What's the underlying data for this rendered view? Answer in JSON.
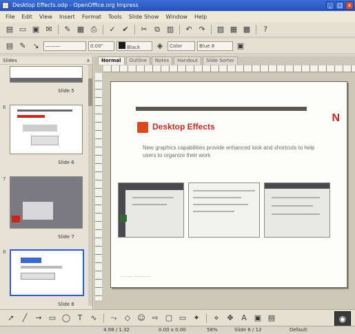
{
  "window": {
    "title": "Desktop Effects.odp - OpenOffice.org Impress",
    "buttons": [
      "_",
      "□",
      "x"
    ]
  },
  "menubar": [
    "File",
    "Edit",
    "View",
    "Insert",
    "Format",
    "Tools",
    "Slide Show",
    "Window",
    "Help"
  ],
  "toolbar2": {
    "line_style": "———",
    "line_width": "0.00\"",
    "color": "Black",
    "area_style": "Color",
    "area_color": "Blue 8"
  },
  "slides_panel": {
    "title": "Slides",
    "close": "x",
    "slides": [
      {
        "num": "",
        "name": "Slide 5"
      },
      {
        "num": "6",
        "name": "Slide 6"
      },
      {
        "num": "7",
        "name": "Slide 7"
      },
      {
        "num": "8",
        "name": "Slide 8"
      }
    ]
  },
  "tabs": [
    "Normal",
    "Outline",
    "Notes",
    "Handout",
    "Slide Sorter"
  ],
  "slide": {
    "title": "Desktop Effects",
    "logo": "N",
    "body": "New graphics capabilities provide enhanced look and shortcuts to help users to organize their work",
    "footer": "-- ----- -----------"
  },
  "statusbar": {
    "position": "4.98 / 1.32",
    "size": "0.00 x 0.00",
    "zoom": "58%",
    "slide": "Slide 8 / 12",
    "layout": "Default"
  },
  "colors": {
    "accent": "#c8281a",
    "selection": "#2a5ad0"
  }
}
